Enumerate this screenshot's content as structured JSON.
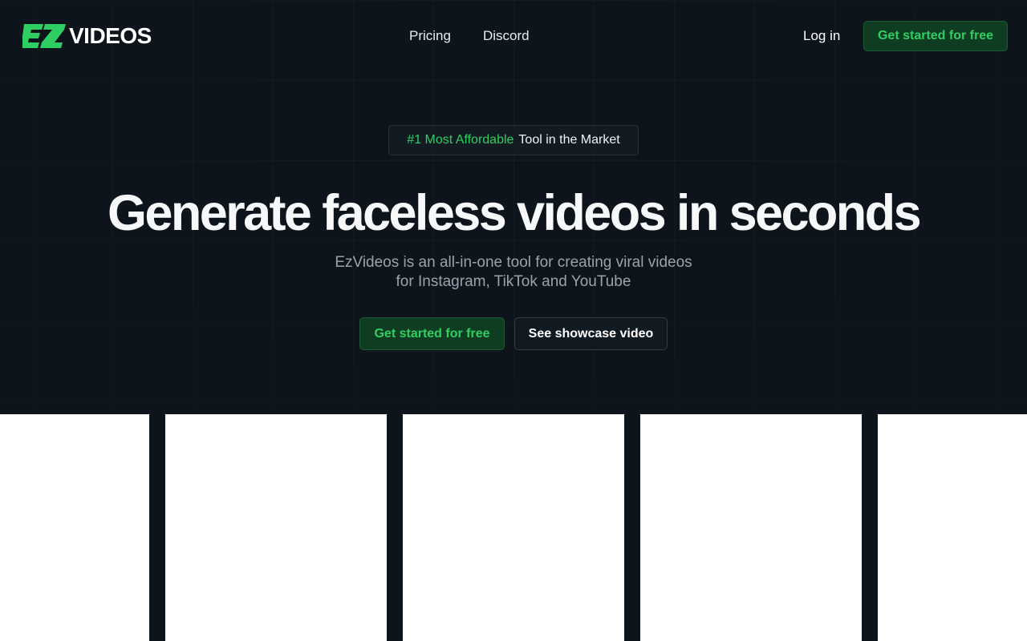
{
  "brand": {
    "name": "VIDEOS",
    "mark_text": "EZ",
    "accent_color": "#2fce63",
    "background_color": "#0d141b"
  },
  "nav": {
    "items": [
      {
        "label": "Pricing"
      },
      {
        "label": "Discord"
      }
    ],
    "login_label": "Log in",
    "cta_label": "Get started for free"
  },
  "hero": {
    "badge": {
      "highlight": "#1 Most Affordable",
      "text": "Tool in the Market"
    },
    "title": "Generate faceless videos in seconds",
    "subtitle_line1": "EzVideos is an all-in-one tool for creating viral videos",
    "subtitle_line2": "for Instagram, TikTok and YouTube",
    "primary_cta": "Get started for free",
    "secondary_cta": "See showcase video"
  },
  "showcase": {
    "cards": [
      {
        "id": "video-card-1"
      },
      {
        "id": "video-card-2"
      },
      {
        "id": "video-card-3"
      },
      {
        "id": "video-card-4"
      },
      {
        "id": "video-card-5"
      }
    ]
  }
}
